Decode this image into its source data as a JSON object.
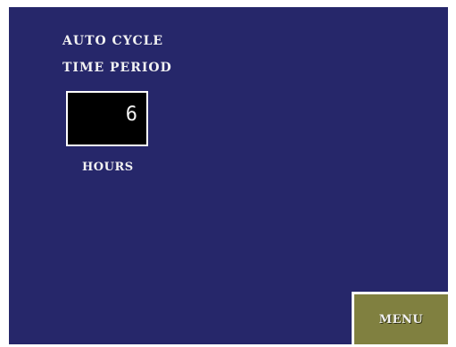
{
  "screen": {
    "title_line_1": "AUTO CYCLE",
    "title_line_2": "TIME PERIOD",
    "background_color": "#26276a"
  },
  "period": {
    "value": "6",
    "unit": "HOURS"
  },
  "menu_button": {
    "label": "MENU",
    "color": "#808040"
  }
}
